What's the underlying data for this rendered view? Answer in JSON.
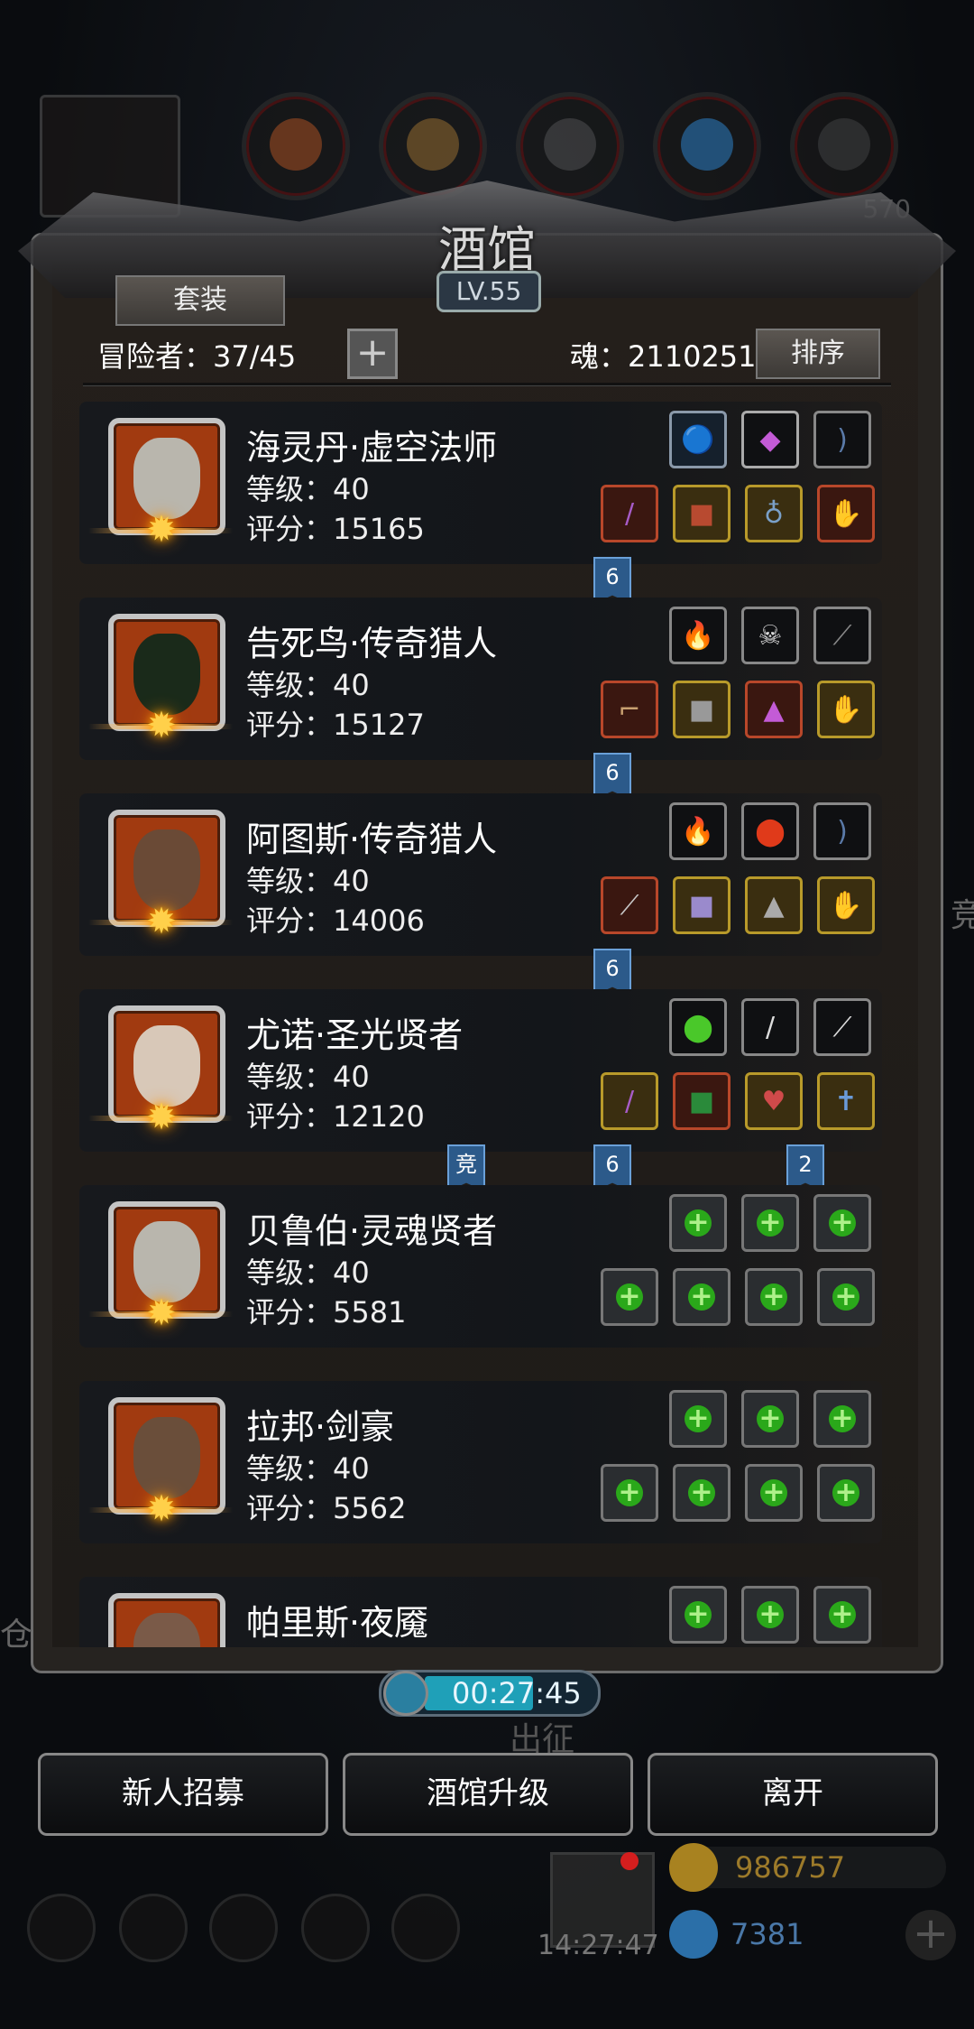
{
  "title": "酒馆",
  "level": "LV.55",
  "top_number": "570",
  "buttons": {
    "set": "套装",
    "sort": "排序",
    "add": "+"
  },
  "adventurers": {
    "label": "冒险者：37/45"
  },
  "soul": {
    "label": "魂：2110251"
  },
  "heroes": [
    {
      "name": "海灵丹·虚空法师",
      "level": "等级：40",
      "score": "评分：15165",
      "badge": "6",
      "color": "#b9b6ad"
    },
    {
      "name": "告死鸟·传奇猎人",
      "level": "等级：40",
      "score": "评分：15127",
      "badge": "6",
      "color": "#1a2a1a"
    },
    {
      "name": "阿图斯·传奇猎人",
      "level": "等级：40",
      "score": "评分：14006",
      "badge": "6",
      "color": "#6a4a36"
    },
    {
      "name": "尤诺·圣光贤者",
      "level": "等级：40",
      "score": "评分：12120",
      "badge": "6",
      "badge_extra": "竞",
      "badge_right": "2",
      "color": "#d8c8b8"
    },
    {
      "name": "贝鲁伯·灵魂贤者",
      "level": "等级：40",
      "score": "评分：5581",
      "color": "#b9b6ad"
    },
    {
      "name": "拉邦·剑豪",
      "level": "等级：40",
      "score": "评分：5562",
      "color": "#6a4e3a"
    },
    {
      "name": "帕里斯·夜魇",
      "level": "",
      "score": "",
      "color": "#7a5a48"
    }
  ],
  "timer": "00:27:45",
  "go_label": "出征",
  "bottom_buttons": {
    "recruit": "新人招募",
    "upgrade": "酒馆升级",
    "leave": "离开"
  },
  "clock": "14:27:47",
  "gold": "986757",
  "gems": "7381",
  "side_text": "竞",
  "side_text2": "仓"
}
